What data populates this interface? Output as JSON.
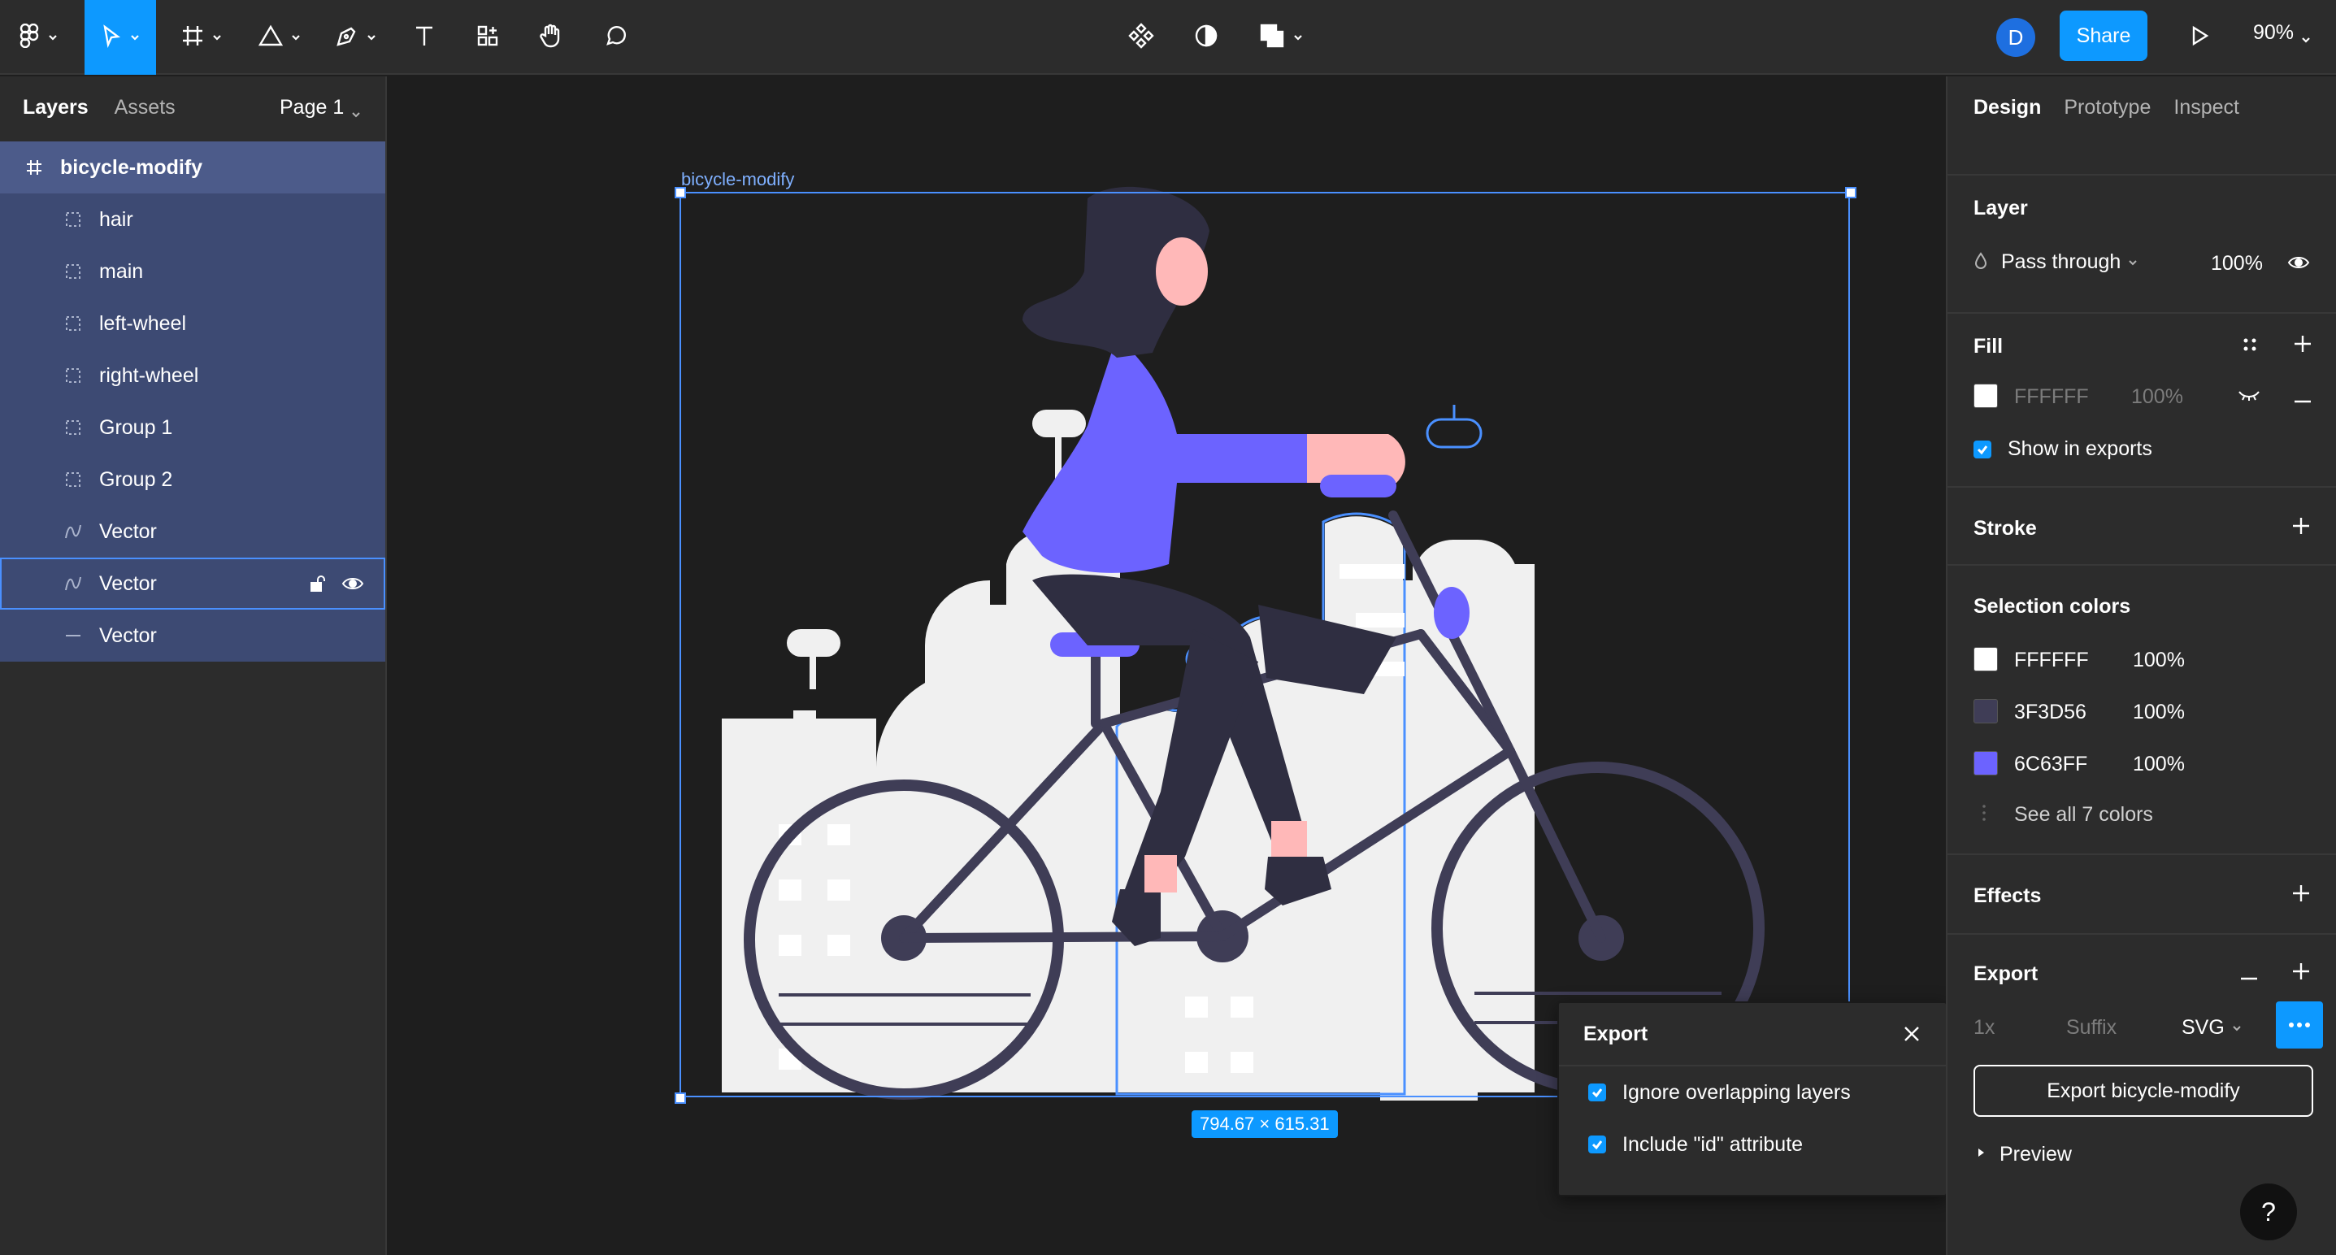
{
  "toolbar": {
    "share_label": "Share",
    "avatar_initial": "D",
    "zoom_label": "90%"
  },
  "left_panel": {
    "tab_layers": "Layers",
    "tab_assets": "Assets",
    "page_label": "Page 1",
    "frame_layer": "bicycle-modify",
    "layers": [
      "hair",
      "main",
      "left-wheel",
      "right-wheel",
      "Group 1",
      "Group 2",
      "Vector",
      "Vector",
      "Vector"
    ]
  },
  "canvas": {
    "frame_label": "bicycle-modify",
    "dimensions": "794.67 × 615.31"
  },
  "export_popover": {
    "title": "Export",
    "option1": "Ignore overlapping layers",
    "option2": "Include \"id\" attribute"
  },
  "right_panel": {
    "tab_design": "Design",
    "tab_prototype": "Prototype",
    "tab_inspect": "Inspect",
    "layer": {
      "title": "Layer",
      "blend": "Pass through",
      "opacity": "100%"
    },
    "fill": {
      "title": "Fill",
      "hex": "FFFFFF",
      "opacity": "100%",
      "show_in_exports": "Show in exports"
    },
    "stroke": {
      "title": "Stroke"
    },
    "selection_colors": {
      "title": "Selection colors",
      "colors": [
        {
          "hex": "FFFFFF",
          "opacity": "100%",
          "swatch": "#FFFFFF"
        },
        {
          "hex": "3F3D56",
          "opacity": "100%",
          "swatch": "#3F3D56"
        },
        {
          "hex": "6C63FF",
          "opacity": "100%",
          "swatch": "#6C63FF"
        }
      ],
      "see_all": "See all 7 colors"
    },
    "effects": {
      "title": "Effects"
    },
    "export": {
      "title": "Export",
      "scale": "1x",
      "suffix_placeholder": "Suffix",
      "format": "SVG",
      "button": "Export bicycle-modify",
      "preview": "Preview"
    }
  },
  "help_label": "?"
}
